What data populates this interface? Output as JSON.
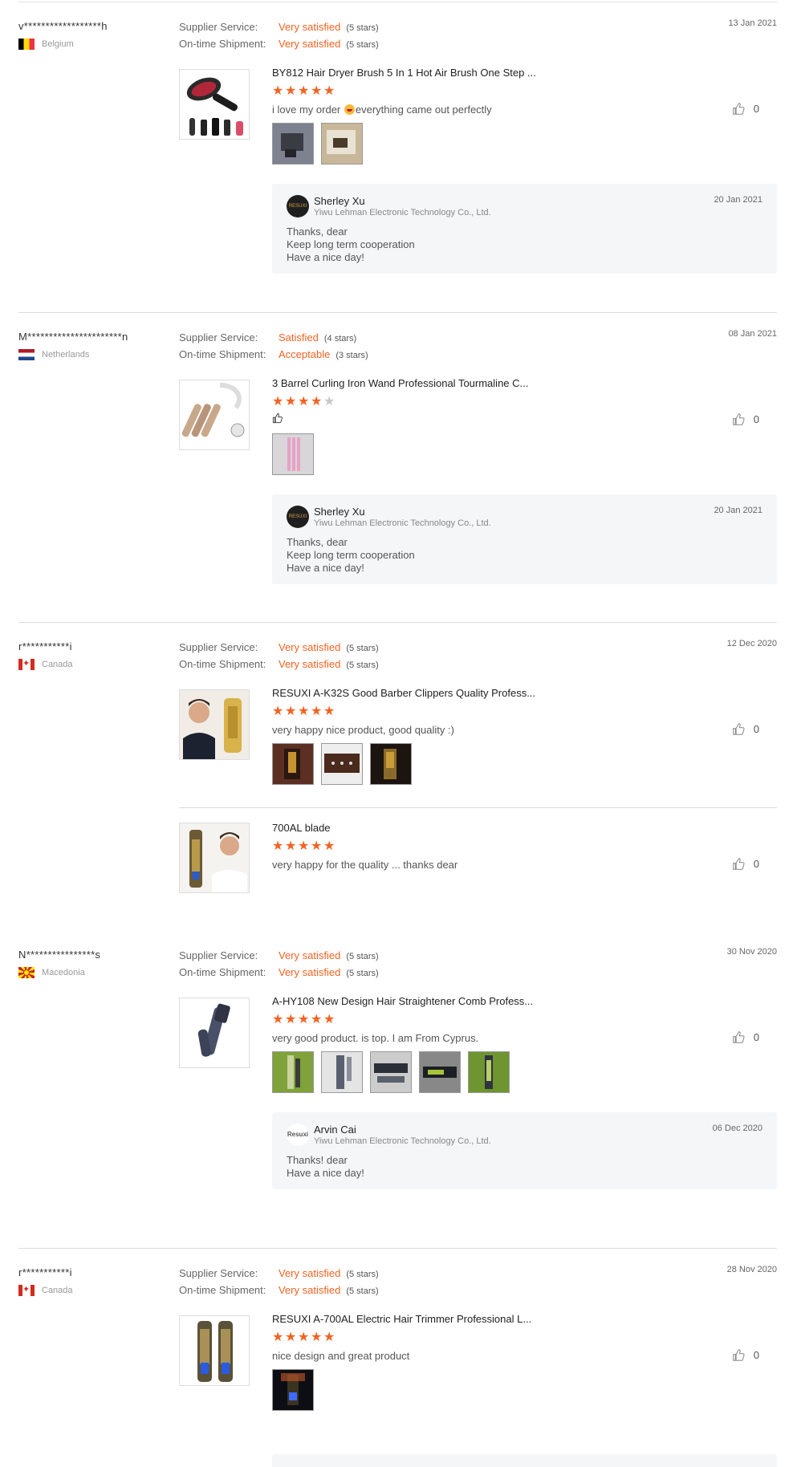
{
  "labels": {
    "supplier_service": "Supplier Service:",
    "on_time_shipment": "On-time Shipment:"
  },
  "reviews": [
    {
      "buyer": "v******************h",
      "country": "Belgium",
      "date": "13 Jan 2021",
      "supplier_service": {
        "value": "Very satisfied",
        "stars": "(5 stars)"
      },
      "on_time_shipment": {
        "value": "Very satisfied",
        "stars": "(5 stars)"
      },
      "products": [
        {
          "title": "BY812 Hair Dryer Brush 5 In 1 Hot Air Brush One Step ...",
          "rating": 5,
          "comment_before": "i love my order ",
          "comment_after": "everything came out perfectly",
          "likes": "0",
          "photo_count": 2
        }
      ],
      "reply": {
        "avatar": "RESUXI",
        "name": "Sherley Xu",
        "company": "Yiwu Lehman Electronic Technology Co., Ltd.",
        "date": "20 Jan 2021",
        "text": "Thanks, dear\nKeep long term cooperation\nHave a nice day!"
      }
    },
    {
      "buyer": "M**********************n",
      "country": "Netherlands",
      "date": "08 Jan 2021",
      "supplier_service": {
        "value": "Satisfied",
        "stars": "(4 stars)"
      },
      "on_time_shipment": {
        "value": "Acceptable",
        "stars": "(3 stars)"
      },
      "products": [
        {
          "title": "3 Barrel Curling Iron Wand Professional Tourmaline C...",
          "rating": 4,
          "comment": "",
          "comment_icon": "thumbs-up-icon",
          "likes": "0",
          "photo_count": 1
        }
      ],
      "reply": {
        "avatar": "RESUXI",
        "name": "Sherley Xu",
        "company": "Yiwu Lehman Electronic Technology Co., Ltd.",
        "date": "20 Jan 2021",
        "text": "Thanks, dear\nKeep long term cooperation\nHave a nice day!"
      }
    },
    {
      "buyer": "r***********i",
      "country": "Canada",
      "date": "12 Dec 2020",
      "supplier_service": {
        "value": "Very satisfied",
        "stars": "(5 stars)"
      },
      "on_time_shipment": {
        "value": "Very satisfied",
        "stars": "(5 stars)"
      },
      "products": [
        {
          "title": "RESUXI A-K32S Good Barber Clippers Quality Profess...",
          "rating": 5,
          "comment": "very happy nice product,  good quality  :)",
          "likes": "0",
          "photo_count": 3
        },
        {
          "title": "700AL blade",
          "rating": 5,
          "comment": "very happy for the quality  ... thanks dear",
          "likes": "0",
          "photo_count": 0
        }
      ]
    },
    {
      "buyer": "N****************s",
      "country": "Macedonia",
      "date": "30 Nov 2020",
      "supplier_service": {
        "value": "Very satisfied",
        "stars": "(5 stars)"
      },
      "on_time_shipment": {
        "value": "Very satisfied",
        "stars": "(5 stars)"
      },
      "products": [
        {
          "title": "A-HY108 New Design Hair Straightener Comb Profess...",
          "rating": 5,
          "comment": "very good product. is top. I am From Cyprus.",
          "likes": "0",
          "photo_count": 5
        }
      ],
      "reply": {
        "avatar": "Resuxi",
        "name": "Arvin Cai",
        "company": "Yiwu Lehman Electronic Technology Co., Ltd.",
        "date": "06 Dec 2020",
        "text": "Thanks!  dear\nHave a nice day!"
      }
    },
    {
      "buyer": "r***********i",
      "country": "Canada",
      "date": "28 Nov 2020",
      "supplier_service": {
        "value": "Very satisfied",
        "stars": "(5 stars)"
      },
      "on_time_shipment": {
        "value": "Very satisfied",
        "stars": "(5 stars)"
      },
      "products": [
        {
          "title": "RESUXI A-700AL Electric Hair Trimmer Professional L...",
          "rating": 5,
          "comment": "nice design and great product",
          "likes": "0",
          "photo_count": 1
        }
      ]
    }
  ]
}
